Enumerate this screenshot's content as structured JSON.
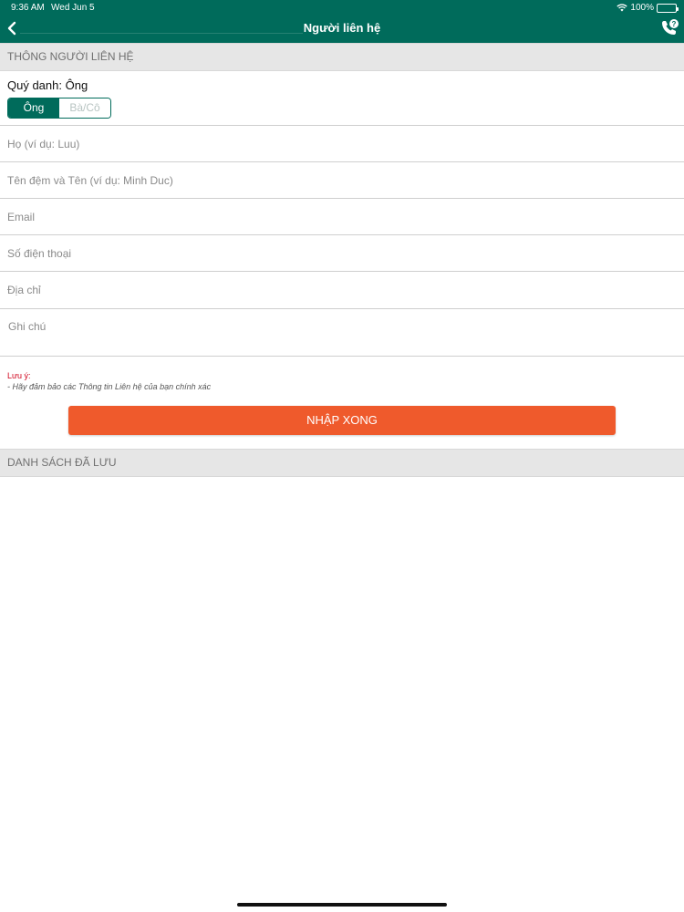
{
  "status_bar": {
    "time": "9:36 AM",
    "date": "Wed Jun 5",
    "battery": "100%"
  },
  "nav": {
    "title": "Người liên hệ",
    "back_icon": "chevron-left-icon",
    "call_icon": "phone-icon"
  },
  "contact_section": {
    "header": "THÔNG NGƯỜI LIÊN HỆ"
  },
  "salutation": {
    "label": "Quý danh: Ông",
    "options": [
      "Ông",
      "Bà/Cô"
    ],
    "selected": "Ông"
  },
  "fields": {
    "last_name_placeholder": "Họ (ví dụ: Luu)",
    "first_name_placeholder": "Tên đệm và Tên (ví dụ: Minh Duc)",
    "email_placeholder": "Email",
    "phone_placeholder": "Số điện thoại",
    "address_placeholder": "Địa chỉ",
    "notes_placeholder": "Ghi chú"
  },
  "note": {
    "title": "Lưu ý:",
    "text": "- Hãy đảm bảo các Thông tin Liên hệ của bạn chính xác"
  },
  "submit_label": "NHẬP XONG",
  "saved_section": {
    "header": "DANH SÁCH ĐÃ LƯU"
  },
  "colors": {
    "primary": "#006b5b",
    "accent": "#ef5a2c",
    "warning": "#d0021b"
  }
}
